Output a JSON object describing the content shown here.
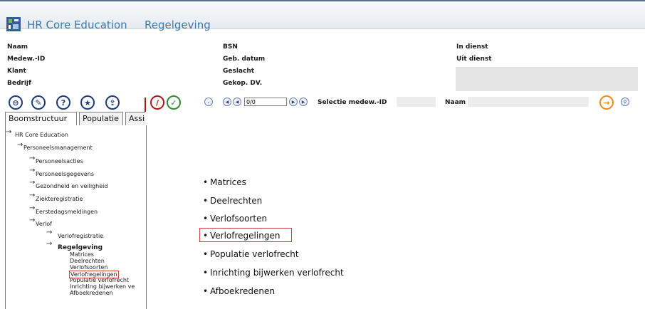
{
  "header": {
    "app_name": "HR Core Education",
    "section": "Regelgeving"
  },
  "info_labels": {
    "naam": "Naam",
    "medew_id": "Medew.-ID",
    "klant": "Klant",
    "bedrijf": "Bedrijf",
    "bsn": "BSN",
    "geb_datum": "Geb. datum",
    "geslacht": "Geslacht",
    "gekop_dv": "Gekop. DV.",
    "in_dienst": "In dienst",
    "uit_dienst": "Uit dienst"
  },
  "toolbar": {
    "icons": [
      "minus-circle-icon",
      "pin-icon",
      "help-icon",
      "star-icon",
      "upload-icon",
      "edit-icon",
      "check-icon"
    ],
    "nav_value": "0/0",
    "selectie_label": "Selectie medew.-ID",
    "naam_label": "Naam"
  },
  "tabs": [
    "Boomstructuur",
    "Populatie",
    "Assis"
  ],
  "tree": {
    "root": "HR Core Education",
    "l1": "Personeelsmanagement",
    "l2": [
      "Personeelsacties",
      "Personeelsgegevens",
      "Gezondheid en veiligheid",
      "Ziekteregistratie",
      "Eerstedagsmeldingen",
      "Verlof"
    ],
    "l3": [
      "Verlofregistratie",
      "Regelgeving"
    ],
    "children": [
      "Matrices",
      "Deelrechten",
      "Verlofsoorten",
      "Verlofregelingen",
      "Populatie verlofrecht",
      "Inrichting bijwerken ve",
      "Afboekredenen"
    ]
  },
  "main_list": [
    "Matrices",
    "Deelrechten",
    "Verlofsoorten",
    "Verlofregelingen",
    "Populatie verlofrecht",
    "Inrichting bijwerken verlofrecht",
    "Afboekredenen"
  ],
  "colors": {
    "title": "#3d79a8",
    "highlight": "#d04040",
    "icon": "#1f3a7a"
  }
}
